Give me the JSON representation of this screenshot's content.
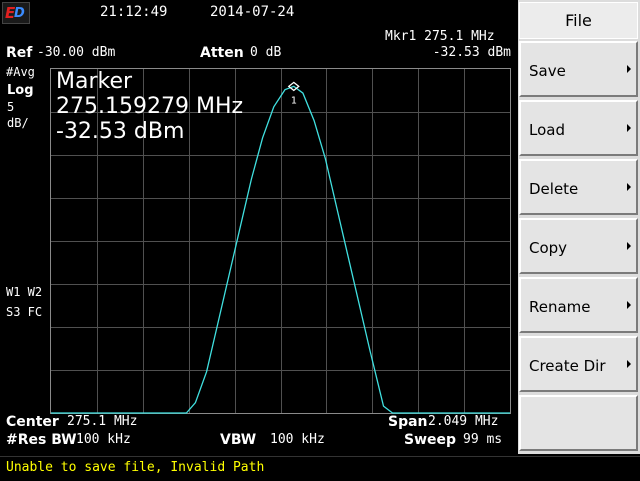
{
  "header": {
    "time": "21:12:49",
    "date": "2014-07-24"
  },
  "logo": {
    "text": "ED"
  },
  "marker_readout": {
    "label": "Mkr1 275.1 MHz",
    "amplitude": "-32.53 dBm"
  },
  "ref": {
    "label": "Ref",
    "value": "-30.00 dBm"
  },
  "atten": {
    "label": "Atten",
    "value": "0 dB"
  },
  "left_annotations": {
    "avg": "#Avg",
    "scale_type": "Log",
    "scale_value": "5",
    "scale_unit": "dB/",
    "traces_line1": "W1 W2",
    "traces_line2": "S3 FC"
  },
  "marker_box": {
    "title": "Marker",
    "frequency": "275.159279 MHz",
    "amplitude": "-32.53 dBm",
    "marker_number": "1"
  },
  "footer": {
    "center_label": "Center",
    "center_value": "275.1 MHz",
    "span_label": "Span",
    "span_value": "2.049 MHz",
    "rbw_label": "#Res BW",
    "rbw_value": "100 kHz",
    "vbw_label": "VBW",
    "vbw_value": "100 kHz",
    "sweep_label": "Sweep",
    "sweep_value": "99 ms"
  },
  "softkeys": {
    "title": "File",
    "items": [
      {
        "label": "Save"
      },
      {
        "label": "Load"
      },
      {
        "label": "Delete"
      },
      {
        "label": "Copy"
      },
      {
        "label": "Rename"
      },
      {
        "label": "Create Dir"
      },
      {
        "label": ""
      }
    ]
  },
  "status_message": "Unable to save file, Invalid Path",
  "colors": {
    "trace": "#40e0e0",
    "message": "#ffff00",
    "softkey_bg": "#e4e4e4",
    "grid": "#505050"
  },
  "chart_data": {
    "type": "line",
    "center_mhz": 275.1,
    "span_mhz": 2.049,
    "ref_dbm": -30.0,
    "scale_db_per_div": 5,
    "divisions": 10,
    "ylim": [
      -80,
      -30
    ],
    "marker": {
      "x_mhz": 275.159279,
      "y_dbm": -32.53
    },
    "series": [
      {
        "x_mhz": [
          274.0755,
          274.68,
          274.72,
          274.77,
          274.82,
          274.87,
          274.92,
          274.97,
          275.02,
          275.07,
          275.12,
          275.159279,
          275.2,
          275.25,
          275.3,
          275.35,
          275.4,
          275.45,
          275.5,
          275.56,
          275.6,
          276.1245
        ],
        "y_dbm": [
          -80,
          -80,
          -78.5,
          -74,
          -67,
          -60,
          -53,
          -46,
          -40,
          -35.5,
          -33,
          -32.53,
          -33.5,
          -37.5,
          -43,
          -50,
          -57,
          -64,
          -71,
          -79,
          -80,
          -80
        ]
      }
    ]
  }
}
